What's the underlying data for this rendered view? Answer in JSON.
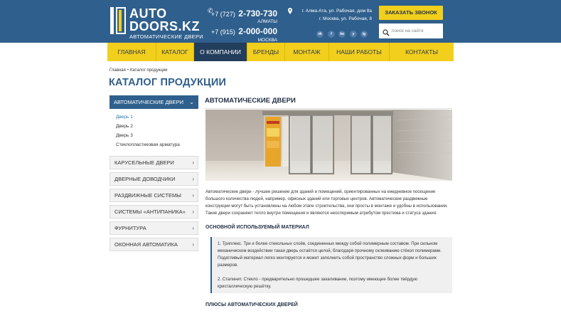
{
  "header": {
    "logo": {
      "line1": "AUTO",
      "line2": "DOORS.KZ",
      "subtitle": "АВТОМАТИЧЕСКИЕ ДВЕРИ"
    },
    "phones": [
      {
        "code": "+7 (727)",
        "number": "2-730-730",
        "city": "АЛМАТЫ"
      },
      {
        "code": "+7 (915)",
        "number": "2-000-000",
        "city": "МОСКВА"
      }
    ],
    "addresses": [
      "г. Алма-Ата, ул. Рабочая, дом 8а",
      "г. Москва, ул. Рабочая, 8"
    ],
    "socials": [
      "vk",
      "f",
      "tw",
      "y",
      "ig"
    ],
    "call_button": "ЗАКАЗАТЬ ЗВОНОК",
    "search_placeholder": "поиск на сайте"
  },
  "nav": {
    "items": [
      "ГЛАВНАЯ",
      "КАТАЛОГ",
      "О КОМПАНИИ",
      "БРЕНДЫ",
      "МОНТАЖ",
      "НАШИ РАБОТЫ",
      "КОНТАКТЫ"
    ],
    "active_index": 2
  },
  "breadcrumb": [
    "Главная",
    "Каталог продукции"
  ],
  "page_title": "КАТАЛОГ ПРОДУКЦИИ",
  "sidebar": {
    "active": "АВТОМАТИЧЕСКИЕ ДВЕРИ",
    "sub_items": [
      "Дверь 1",
      "Дверь 2",
      "Дверь 3",
      "Стеклопластиковая арматура"
    ],
    "items": [
      "КАРУСЕЛЬНЫЕ ДВЕРИ",
      "ДВЕРНЫЕ ДОВОДЧИКИ",
      "РАЗДВИЖНЫЕ СИСТЕМЫ",
      "СИСТЕМЫ «АНТИПАНИКА»",
      "ФУРНИТУРА",
      "ОКОННАЯ АВТОМАТИКА"
    ]
  },
  "content": {
    "title": "АВТОМАТИЧЕСКИЕ ДВЕРИ",
    "intro": "Автоматические двери - лучшее решение для зданий и помещений, ориентированных на ежедневное посещение большого количества людей, например, офисных зданий или торговых центров. Автоматические раздвижные конструкции могут быть установлены на любом этапе строительства, они просты в монтаже и удобны в использовании. Такие двери сохраняют тепло внутри помещения и являются неоспоримым атрибутом престижа и статуса здания.",
    "heading_material": "ОСНОВНОЙ ИСПОЛЬЗУЕМЫЙ МАТЕРИАЛ",
    "material_1": "1. Триплекс. Три и более стекольных слоёв, соединенных между собой полимерным составом. При сильном механическом воздействии такая дверь остаётся целой, благодаря прочному склеиванию стёкол полимерами. Податливый материал легко монтируется и может заполнить собой пространство сложных форм и больших размеров.",
    "material_2": "2. Сталинит. Стекло - предварительно прошедшее закаливание, поэтому имеющее более твёрдую кристаллическую решётку.",
    "heading_pros": "ПЛЮСЫ АВТОМАТИЧЕСКИХ ДВЕРЕЙ"
  },
  "colors": {
    "header_bg": "#2f5f8c",
    "accent_yellow": "#f2cf1c",
    "nav_active": "#233d5c"
  }
}
